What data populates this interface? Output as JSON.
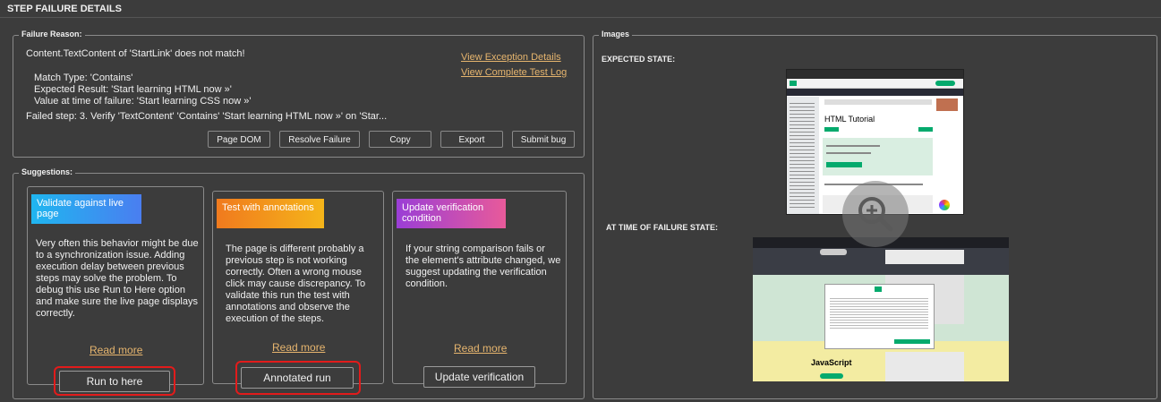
{
  "header": {
    "title": "STEP FAILURE DETAILS"
  },
  "failure": {
    "legend": "Failure Reason:",
    "message": "Content.TextContent of 'StartLink' does not match!",
    "match_type": "Match Type: 'Contains'",
    "expected": "Expected Result: 'Start learning HTML now »'",
    "actual": "Value at time of failure: 'Start learning CSS now »'",
    "failed_step": "Failed step: 3. Verify 'TextContent' 'Contains' 'Start learning HTML now »' on 'Star...",
    "links": {
      "exception": "View Exception Details",
      "test_log": "View Complete Test Log"
    },
    "buttons": {
      "page_dom": "Page DOM",
      "resolve": "Resolve Failure",
      "copy": "Copy",
      "export": "Export",
      "submit_bug": "Submit bug"
    }
  },
  "suggestions": {
    "legend": "Suggestions:",
    "cards": [
      {
        "title": "Validate against live page",
        "color_start": "#1fb6f0",
        "color_end": "#4a7ef0",
        "body": "Very often this behavior might be due to a synchronization issue. Adding execution delay between previous steps may solve the problem. To debug this use Run to Here option and make sure the live page displays correctly.",
        "read_more": "Read more",
        "button": "Run to here"
      },
      {
        "title": "Test with annotations",
        "color_start": "#f07a1e",
        "color_end": "#f5b51a",
        "body": "The page is different probably a previous step is not working correctly. Often a wrong mouse click may cause discrepancy. To validate this run the test with annotations and observe the execution of the steps.",
        "read_more": "Read more",
        "button": "Annotated run"
      },
      {
        "title": "Update verification condition",
        "color_start": "#9a3ed6",
        "color_end": "#e85a9a",
        "body": "If your string comparison fails or the element's attribute changed, we suggest updating the verification condition.",
        "read_more": "Read more",
        "button": "Update verification"
      }
    ]
  },
  "images": {
    "legend": "Images",
    "expected_label": "EXPECTED STATE:",
    "failure_label": "AT TIME OF FAILURE STATE:",
    "expected_heading": "HTML Tutorial",
    "failure_heading": "JavaScript"
  },
  "colors": {
    "background": "#3c3c3c",
    "link": "#e6b56e",
    "highlight": "#e21b1b"
  }
}
